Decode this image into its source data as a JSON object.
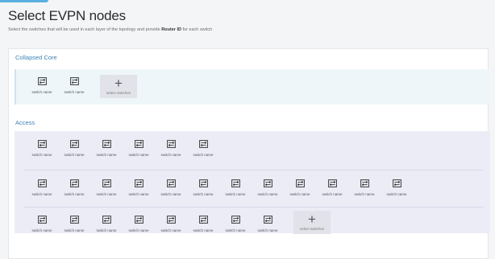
{
  "header": {
    "title": "Select EVPN nodes",
    "subtitle_pre": "Select the switches that will be used in each layer of the topology and provide",
    "subtitle_bold": "Router ID",
    "subtitle_post": "for each switch"
  },
  "sections": {
    "collapsed_core": {
      "title": "Collapsed Core",
      "switches": [
        "switch name",
        "switch name"
      ],
      "add_label": "select switches"
    },
    "access": {
      "title": "Access",
      "row1": [
        "switch name",
        "switch name",
        "switch name",
        "switch name",
        "switch name",
        "switch name"
      ],
      "row2": [
        "switch name",
        "switch name",
        "switch name",
        "switch name",
        "switch name",
        "switch name",
        "switch name",
        "switch name",
        "switch name",
        "switch name",
        "switch name",
        "switch name"
      ],
      "row3": [
        "switch name",
        "switch name",
        "switch name",
        "switch name",
        "switch name",
        "switch name",
        "switch name",
        "switch name"
      ],
      "add_label": "select switches"
    }
  },
  "icons": {
    "switch": "switch-icon",
    "add": "plus-icon"
  },
  "colors": {
    "section_title": "#3d83b8",
    "core_background": "#eef6fa",
    "access_background": "#ececf7"
  }
}
